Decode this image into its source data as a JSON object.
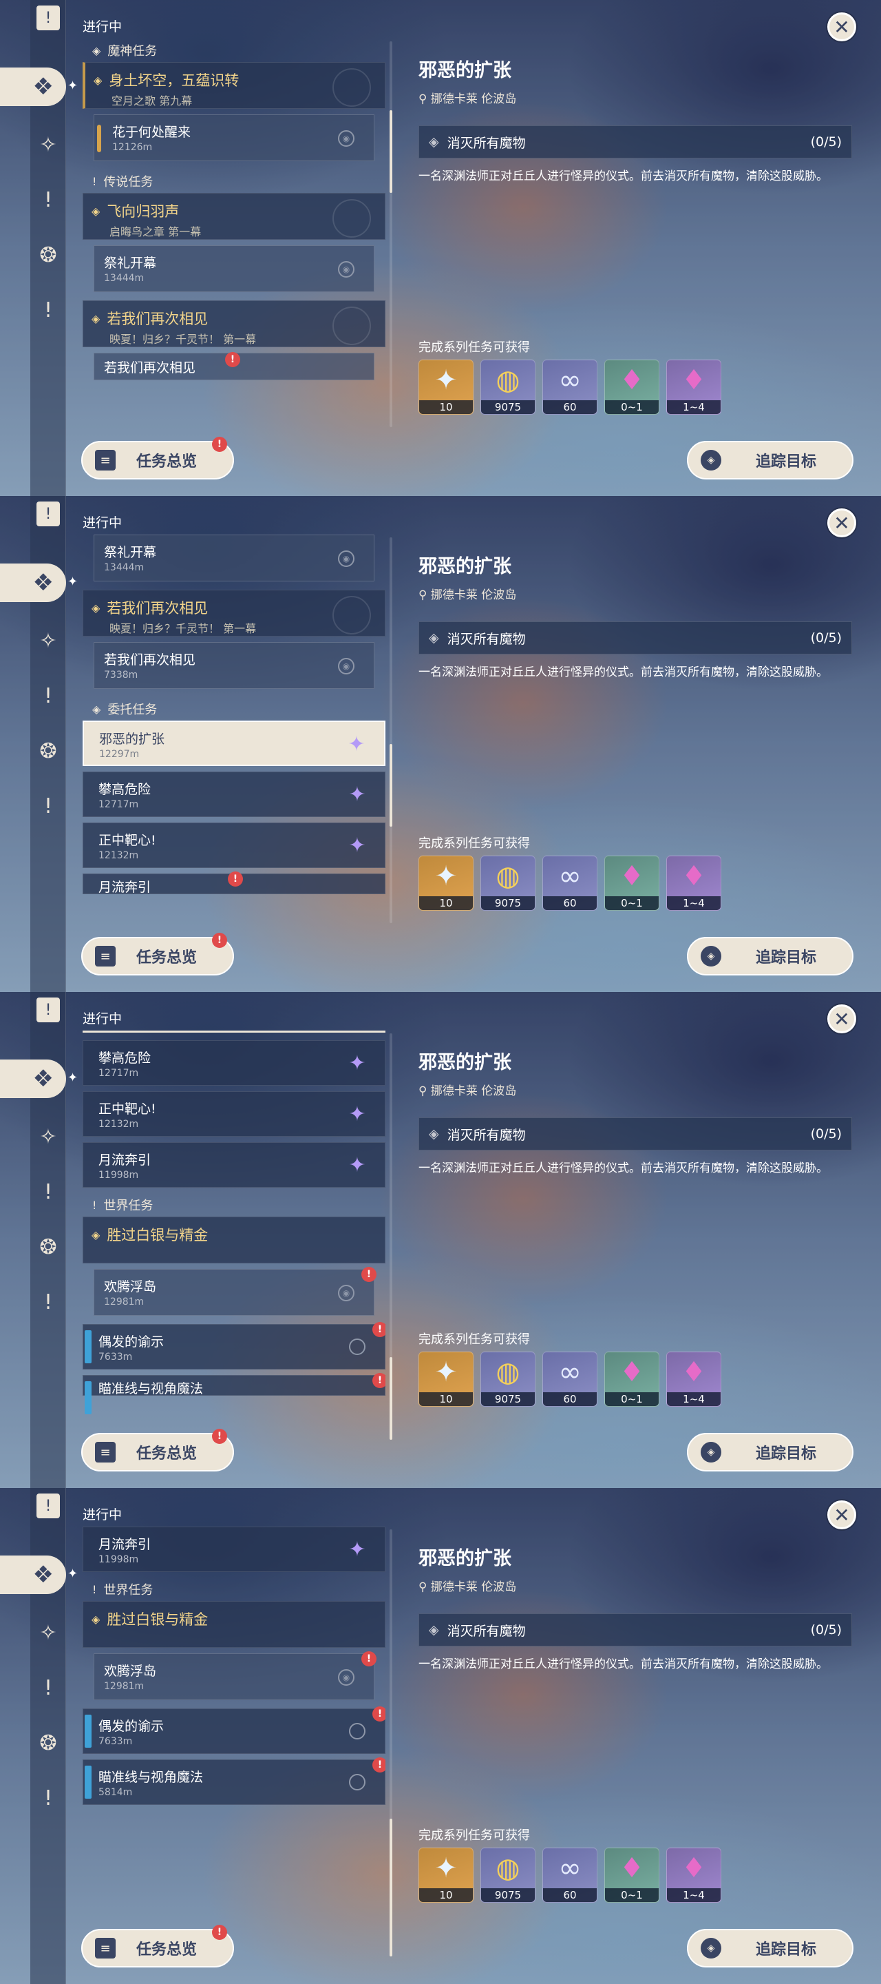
{
  "header": {
    "status": "进行中"
  },
  "rail": {
    "flag_icon": "bookmark-flag-icon",
    "items": [
      "archon-quest-icon",
      "story-quest-icon",
      "commission-icon",
      "world-quest-icon",
      "event-quest-icon",
      "alert-quest-icon"
    ]
  },
  "sections": {
    "archon": "魔神任务",
    "legend": "传说任务",
    "commission": "委托任务",
    "world": "世界任务"
  },
  "quests": {
    "archon_group": {
      "title": "身土坏空，五蕴识转",
      "sub": "空月之歌 第九幕"
    },
    "archon_sub": {
      "name": "花于何处醒来",
      "distance": "12126m"
    },
    "legend_group": {
      "title": "飞向归羽声",
      "sub": "启晦鸟之章 第一幕"
    },
    "legend_sub": {
      "name": "祭礼开幕",
      "distance": "13444m"
    },
    "event_group": {
      "title": "若我们再次相见",
      "sub": "映夏！归乡？千灵节！ 第一幕"
    },
    "event_sub": {
      "name": "若我们再次相见",
      "distance": "7338m"
    },
    "commission_items": [
      {
        "name": "邪恶的扩张",
        "distance": "12297m"
      },
      {
        "name": "攀高危险",
        "distance": "12717m"
      },
      {
        "name": "正中靶心!",
        "distance": "12132m"
      },
      {
        "name": "月流奔引",
        "distance": "11998m"
      }
    ],
    "world_group": {
      "title": "胜过白银与精金"
    },
    "world_sub": {
      "name": "欢腾浮岛",
      "distance": "12981m"
    },
    "world_items": [
      {
        "name": "偶发的谕示",
        "distance": "7633m"
      },
      {
        "name": "瞄准线与视角魔法",
        "distance": "5814m"
      }
    ]
  },
  "detail": {
    "title": "邪恶的扩张",
    "location": "挪德卡莱 伦波岛",
    "objective": "消灭所有魔物",
    "progress": "(0/5)",
    "description": "一名深渊法师正对丘丘人进行怪异的仪式。前去消灭所有魔物，清除这股威胁。",
    "rewards_label": "完成系列任务可获得",
    "rewards": [
      {
        "icon": "primogem-icon",
        "qty": "10",
        "color": "#c08a3c"
      },
      {
        "icon": "mora-icon",
        "qty": "9075",
        "color": "#6a6fa8"
      },
      {
        "icon": "companionship-exp-icon",
        "qty": "60",
        "color": "#6a6fa8"
      },
      {
        "icon": "crystal-chunk-icon",
        "qty": "0~1",
        "color": "#5c8a80"
      },
      {
        "icon": "crystal-cluster-icon",
        "qty": "1~4",
        "color": "#7d6aa8"
      }
    ]
  },
  "buttons": {
    "overview": "任务总览",
    "track": "追踪目标"
  }
}
